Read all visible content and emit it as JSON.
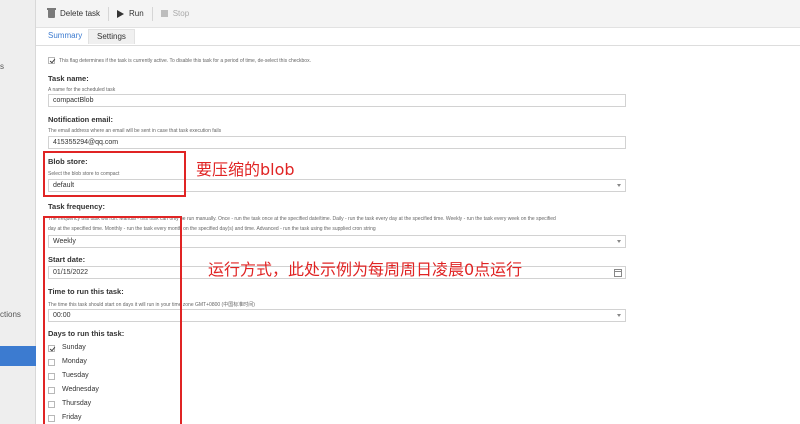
{
  "sidebar": {
    "fragments": [
      "s",
      "ctions"
    ]
  },
  "toolbar": {
    "delete_label": "Delete task",
    "run_label": "Run",
    "stop_label": "Stop"
  },
  "tabs": [
    {
      "label": "Summary",
      "active": true
    },
    {
      "label": "Settings",
      "active": false
    }
  ],
  "form": {
    "enabled_hint": "This flag determines if the task is currently active. To disable this task for a period of time, de-select this checkbox.",
    "enabled_checked": true,
    "task_name": {
      "label": "Task name:",
      "hint": "A name for the scheduled task",
      "value": "compactBlob"
    },
    "notification_email": {
      "label": "Notification email:",
      "hint": "The email address where an email will be sent in case that task execution fails",
      "value": "415355294@qq.com"
    },
    "blob_store": {
      "label": "Blob store:",
      "hint": "Select the blob store to compact",
      "value": "default"
    },
    "task_frequency": {
      "label": "Task frequency:",
      "hint_line1": "The frequency this task will run. Manual - this task can only be run manually. Once - run the task once at the specified date/time. Daily - run the task every day at the specified time. Weekly - run the task every week on the specified",
      "hint_line2": "day at the specified time. Monthly - run the task every month on the specified day(s) and time. Advanced - run the task using the supplied cron string",
      "value": "Weekly"
    },
    "start_date": {
      "label": "Start date:",
      "value": "01/15/2022"
    },
    "run_time": {
      "label": "Time to run this task:",
      "hint": "The time this task should start on days it will run in your time zone GMT+0800 (中国标准时间)",
      "value": "00:00"
    },
    "days": {
      "label": "Days to run this task:",
      "items": [
        {
          "label": "Sunday",
          "checked": true
        },
        {
          "label": "Monday",
          "checked": false
        },
        {
          "label": "Tuesday",
          "checked": false
        },
        {
          "label": "Wednesday",
          "checked": false
        },
        {
          "label": "Thursday",
          "checked": false
        },
        {
          "label": "Friday",
          "checked": false
        }
      ]
    }
  },
  "annotations": {
    "blob_note": "要压缩的blob",
    "schedule_note": "运行方式，此处示例为每周周日凌晨0点运行",
    "color": "#e02424"
  },
  "colors": {
    "accent": "#3c7bd0",
    "annotation": "#e02424"
  }
}
